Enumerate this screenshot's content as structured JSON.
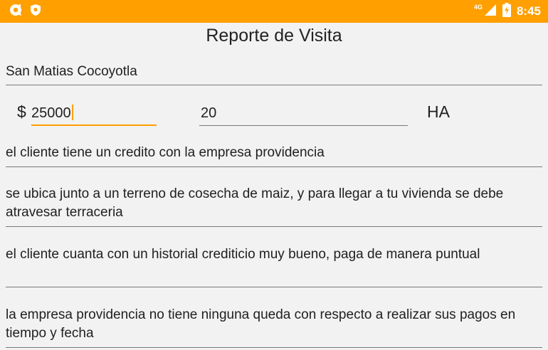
{
  "status_bar": {
    "network_label": "4G",
    "time": "8:45",
    "accent": "#ff9f00"
  },
  "page": {
    "title": "Reporte de Visita"
  },
  "location": {
    "value": "San Matias Cocoyotla"
  },
  "amount": {
    "currency_symbol": "$",
    "value": "25000"
  },
  "area": {
    "value": "20",
    "unit": "HA"
  },
  "notes": [
    {
      "value": "el cliente tiene un credito con la empresa providencia"
    },
    {
      "value": "se ubica junto a un terreno de cosecha de maiz, y para llegar a tu vivienda se debe atravesar terraceria"
    },
    {
      "value": "el cliente cuanta con un historial crediticio muy bueno, paga de manera puntual"
    },
    {
      "value": "la empresa providencia no tiene ninguna queda con respecto a realizar sus pagos en tiempo y fecha"
    }
  ]
}
